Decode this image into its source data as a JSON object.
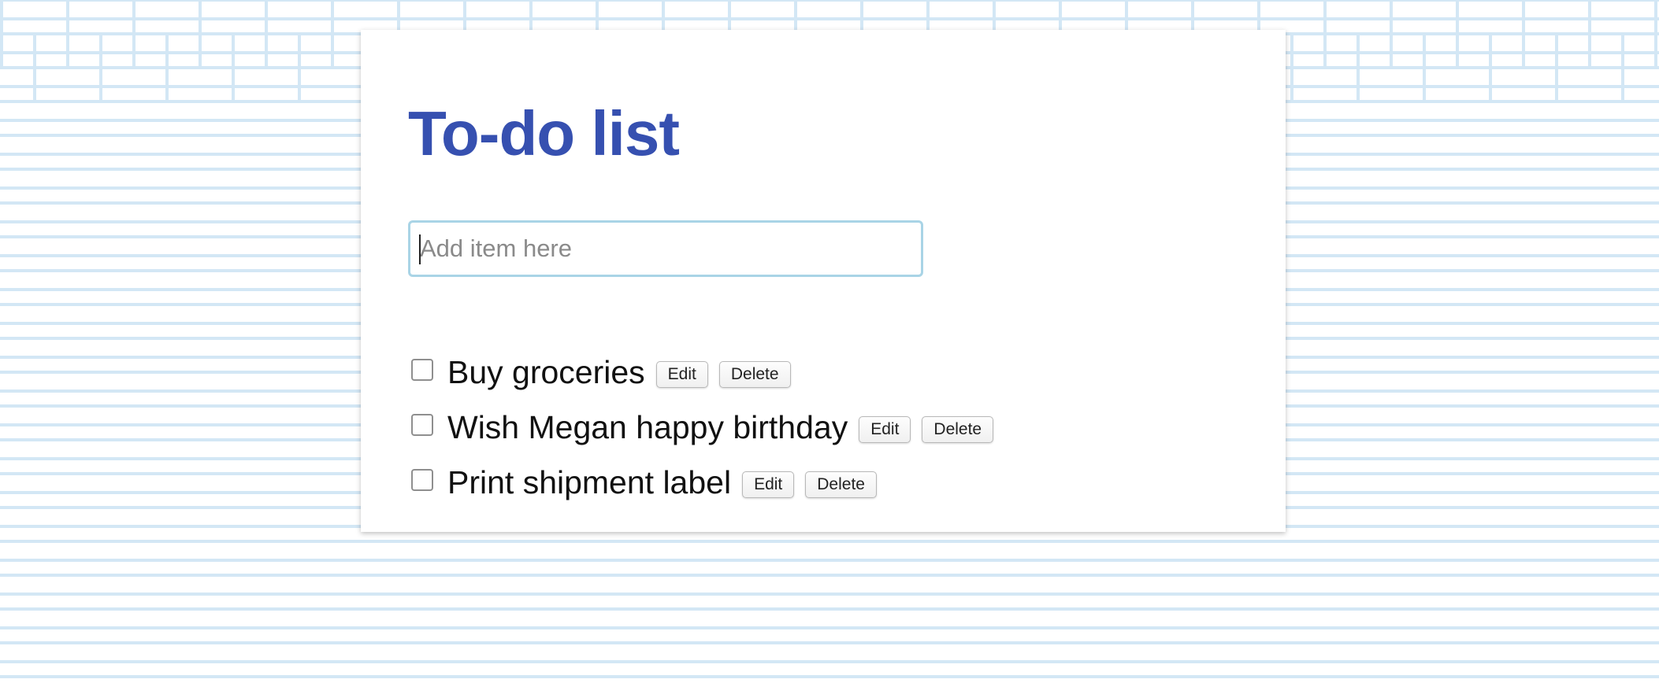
{
  "title": "To-do list",
  "input": {
    "value": "",
    "placeholder": "Add item here"
  },
  "todos": [
    {
      "text": "Buy groceries",
      "checked": false,
      "edit_label": "Edit",
      "delete_label": "Delete"
    },
    {
      "text": "Wish Megan happy birthday",
      "checked": false,
      "edit_label": "Edit",
      "delete_label": "Delete"
    },
    {
      "text": "Print shipment label",
      "checked": false,
      "edit_label": "Edit",
      "delete_label": "Delete"
    }
  ],
  "colors": {
    "title": "#3650b0",
    "input_border": "#a9d4e6",
    "brick_lines": "#d3e7f5"
  }
}
